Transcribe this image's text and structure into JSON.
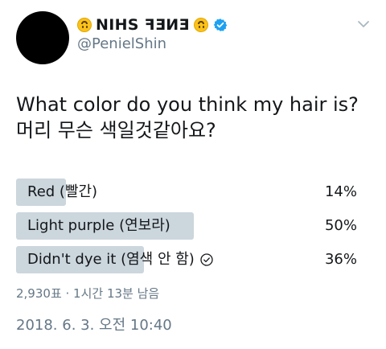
{
  "tweet": {
    "display_name": "NIHS ꟻƎИƎ",
    "handle": "@PenielShin",
    "text_line1": "What color do you think my hair is?",
    "text_line2": "머리 무슨 색일것같아요?"
  },
  "poll": {
    "options": [
      {
        "label": "Red (빨간)",
        "percent_label": "14%",
        "percent": 14,
        "selected": false
      },
      {
        "label": "Light purple (연보라)",
        "percent_label": "50%",
        "percent": 50,
        "selected": false
      },
      {
        "label": "Didn't dye it (염색 안 함)",
        "percent_label": "36%",
        "percent": 36,
        "selected": true
      }
    ],
    "meta": "2,930표 · 1시간 13분 남음"
  },
  "timestamp": "2018. 6. 3. 오전 10:40",
  "colors": {
    "bar": "#ccd6dd",
    "verified": "#1da1f2",
    "secondary_text": "#657786"
  }
}
